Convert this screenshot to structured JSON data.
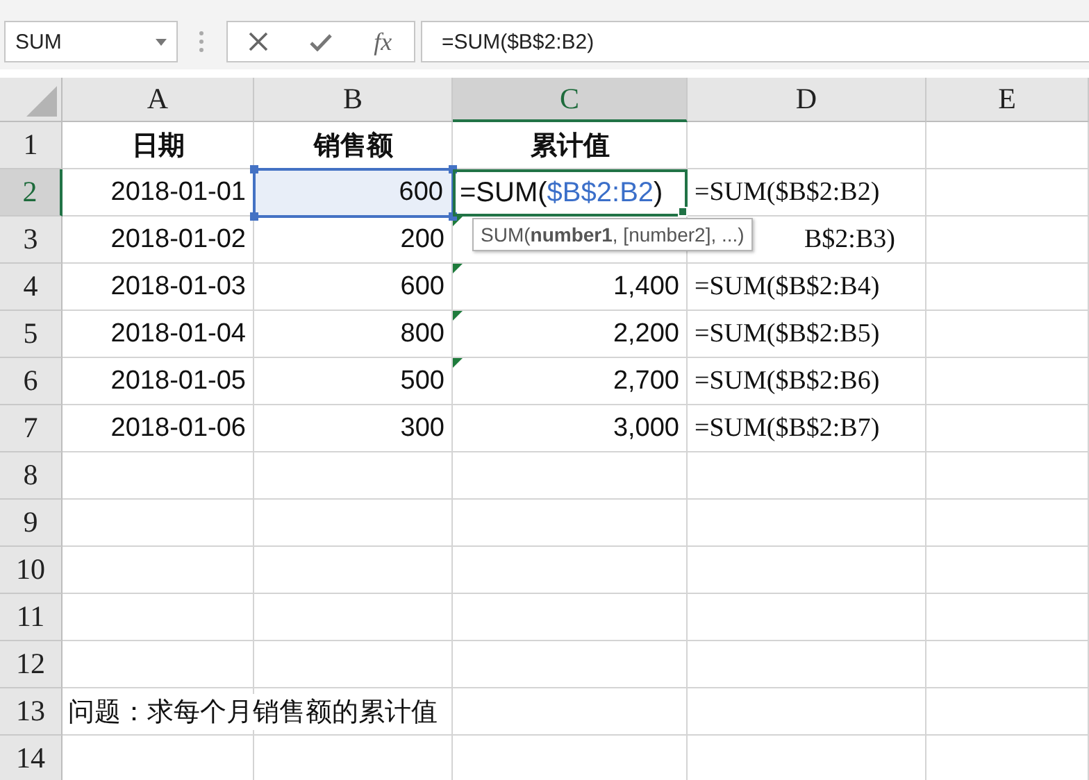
{
  "name_box": {
    "value": "SUM"
  },
  "formula_bar": {
    "function_button": "fx",
    "value": "=SUM($B$2:B2)"
  },
  "columns": [
    {
      "label": "A",
      "selected": false
    },
    {
      "label": "B",
      "selected": false
    },
    {
      "label": "C",
      "selected": true
    },
    {
      "label": "D",
      "selected": false
    },
    {
      "label": "E",
      "selected": false
    }
  ],
  "rows": [
    {
      "label": "1",
      "selected": false,
      "cells": [
        {
          "kind": "header",
          "text": "日期"
        },
        {
          "kind": "header",
          "text": "销售额"
        },
        {
          "kind": "header",
          "text": "累计值"
        },
        {
          "kind": "empty"
        },
        {
          "kind": "empty"
        }
      ]
    },
    {
      "label": "2",
      "selected": true,
      "cells": [
        {
          "kind": "number",
          "text": "2018-01-01"
        },
        {
          "kind": "referenced",
          "text": "600"
        },
        {
          "kind": "editing",
          "parts": [
            {
              "kind": "plain",
              "text": "=SUM("
            },
            {
              "kind": "reference",
              "text": "$B$2:B2"
            },
            {
              "kind": "plain",
              "text": ")"
            }
          ]
        },
        {
          "kind": "formula",
          "text": "=SUM($B$2:B2)"
        },
        {
          "kind": "empty"
        }
      ]
    },
    {
      "label": "3",
      "selected": false,
      "cells": [
        {
          "kind": "number",
          "text": "2018-01-02"
        },
        {
          "kind": "number",
          "text": "200"
        },
        {
          "kind": "flagged"
        },
        {
          "kind": "covered",
          "text": "B$2:B3)"
        },
        {
          "kind": "empty"
        }
      ]
    },
    {
      "label": "4",
      "selected": false,
      "cells": [
        {
          "kind": "number",
          "text": "2018-01-03"
        },
        {
          "kind": "number",
          "text": "600"
        },
        {
          "kind": "flagged",
          "text": "1,400"
        },
        {
          "kind": "formula",
          "text": "=SUM($B$2:B4)"
        },
        {
          "kind": "empty"
        }
      ]
    },
    {
      "label": "5",
      "selected": false,
      "cells": [
        {
          "kind": "number",
          "text": "2018-01-04"
        },
        {
          "kind": "number",
          "text": "800"
        },
        {
          "kind": "flagged",
          "text": "2,200"
        },
        {
          "kind": "formula",
          "text": "=SUM($B$2:B5)"
        },
        {
          "kind": "empty"
        }
      ]
    },
    {
      "label": "6",
      "selected": false,
      "cells": [
        {
          "kind": "number",
          "text": "2018-01-05"
        },
        {
          "kind": "number",
          "text": "500"
        },
        {
          "kind": "flagged",
          "text": "2,700"
        },
        {
          "kind": "formula",
          "text": "=SUM($B$2:B6)"
        },
        {
          "kind": "empty"
        }
      ]
    },
    {
      "label": "7",
      "selected": false,
      "cells": [
        {
          "kind": "number",
          "text": "2018-01-06"
        },
        {
          "kind": "number",
          "text": "300"
        },
        {
          "kind": "number",
          "text": "3,000"
        },
        {
          "kind": "formula",
          "text": "=SUM($B$2:B7)"
        },
        {
          "kind": "empty"
        }
      ]
    },
    {
      "label": "8",
      "selected": false,
      "cells": []
    },
    {
      "label": "9",
      "selected": false,
      "cells": []
    },
    {
      "label": "10",
      "selected": false,
      "cells": []
    },
    {
      "label": "11",
      "selected": false,
      "cells": []
    },
    {
      "label": "12",
      "selected": false,
      "cells": []
    },
    {
      "label": "13",
      "selected": false,
      "cells": [
        {
          "kind": "note",
          "text": "问题：求每个月销售额的累计值"
        }
      ]
    },
    {
      "label": "14",
      "selected": false,
      "cells": []
    }
  ],
  "tooltip": {
    "text": "SUM(**number1**, [number2], ...)"
  }
}
